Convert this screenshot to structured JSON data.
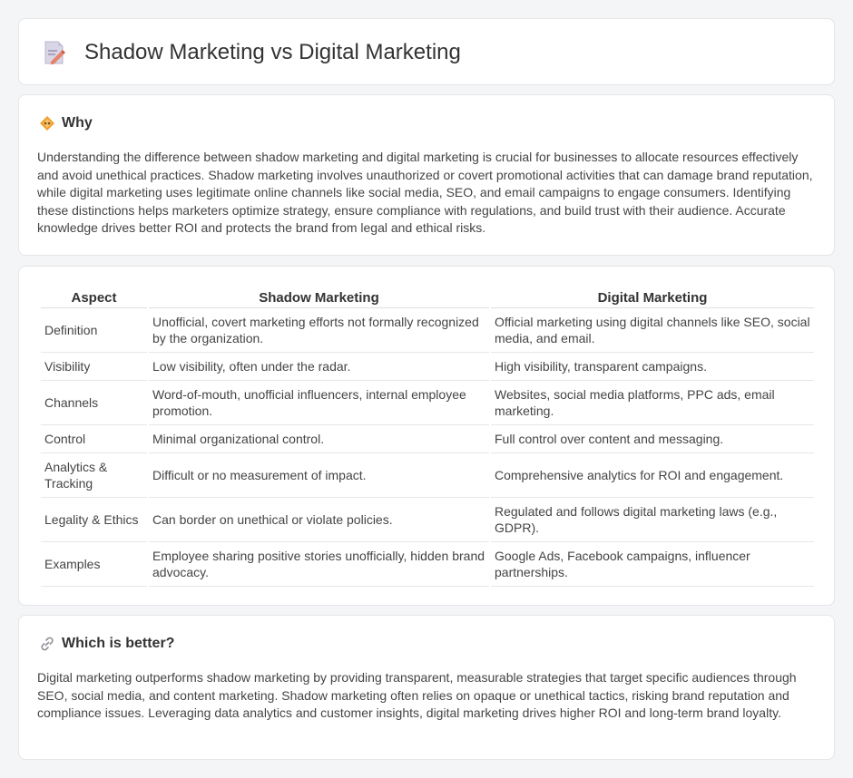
{
  "header": {
    "title": "Shadow Marketing vs Digital Marketing",
    "icon": "document-pencil-icon"
  },
  "why": {
    "title": "Why",
    "icon": "diamond-icon",
    "body": "Understanding the difference between shadow marketing and digital marketing is crucial for businesses to allocate resources effectively and avoid unethical practices. Shadow marketing involves unauthorized or covert promotional activities that can damage brand reputation, while digital marketing uses legitimate online channels like social media, SEO, and email campaigns to engage consumers. Identifying these distinctions helps marketers optimize strategy, ensure compliance with regulations, and build trust with their audience. Accurate knowledge drives better ROI and protects the brand from legal and ethical risks."
  },
  "table": {
    "headers": [
      "Aspect",
      "Shadow Marketing",
      "Digital Marketing"
    ],
    "rows": [
      [
        "Definition",
        "Unofficial, covert marketing efforts not formally recognized by the organization.",
        "Official marketing using digital channels like SEO, social media, and email."
      ],
      [
        "Visibility",
        "Low visibility, often under the radar.",
        "High visibility, transparent campaigns."
      ],
      [
        "Channels",
        "Word-of-mouth, unofficial influencers, internal employee promotion.",
        "Websites, social media platforms, PPC ads, email marketing."
      ],
      [
        "Control",
        "Minimal organizational control.",
        "Full control over content and messaging."
      ],
      [
        "Analytics & Tracking",
        "Difficult or no measurement of impact.",
        "Comprehensive analytics for ROI and engagement."
      ],
      [
        "Legality & Ethics",
        "Can border on unethical or violate policies.",
        "Regulated and follows digital marketing laws (e.g., GDPR)."
      ],
      [
        "Examples",
        "Employee sharing positive stories unofficially, hidden brand advocacy.",
        "Google Ads, Facebook campaigns, influencer partnerships."
      ]
    ]
  },
  "better": {
    "title": "Which is better?",
    "icon": "link-icon",
    "body": "Digital marketing outperforms shadow marketing by providing transparent, measurable strategies that target specific audiences through SEO, social media, and content marketing. Shadow marketing often relies on opaque or unethical tactics, risking brand reputation and compliance issues. Leveraging data analytics and customer insights, digital marketing drives higher ROI and long-term brand loyalty."
  },
  "colors": {
    "page_background": "#f4f5f7",
    "card_background": "#ffffff",
    "diamond_icon": "#f0a030",
    "doc_icon_accent": "#e8826a"
  }
}
